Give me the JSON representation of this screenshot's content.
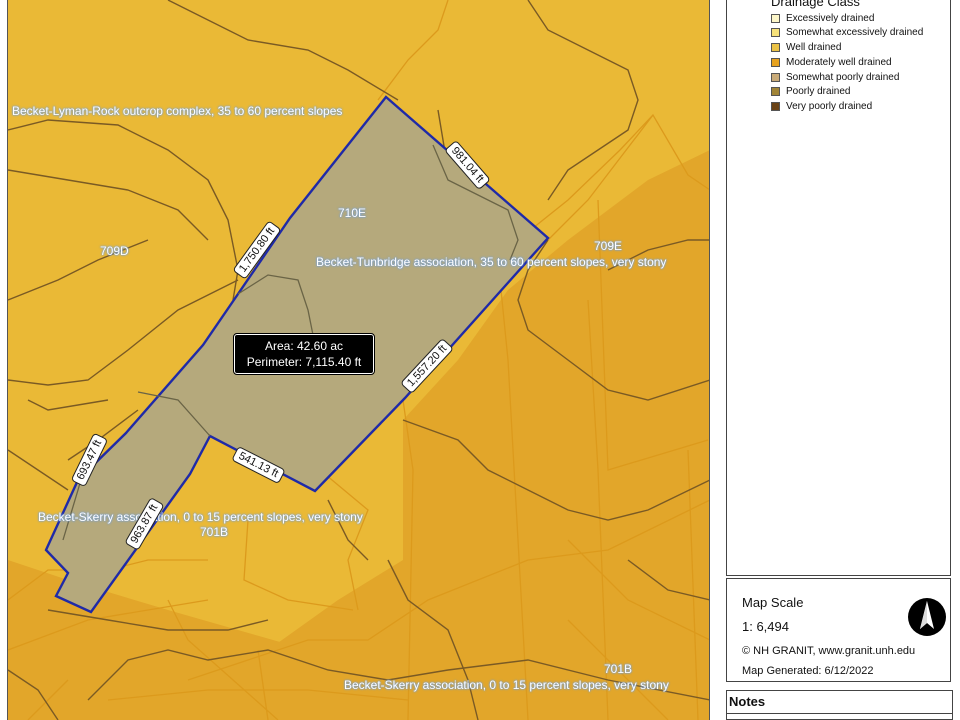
{
  "map": {
    "soil_units": [
      {
        "name": "Becket-Lyman-Rock outcrop complex, 35 to 60 percent slopes"
      },
      {
        "name": "Becket-Tunbridge association, 35 to 60 percent slopes, very stony"
      },
      {
        "name": "Becket-Skerry association, 0 to 15 percent slopes, very stony"
      },
      {
        "name": "Becket-Skerry association, 0 to 15 percent slopes, very stony"
      }
    ],
    "map_units": [
      "709D",
      "710E",
      "709E",
      "701B",
      "701B"
    ],
    "dimensions": [
      "981.04 ft",
      "1,750.80 ft",
      "1,557.20 ft",
      "693.47 ft",
      "541.13 ft",
      "963.87 ft"
    ],
    "area_text": "Area: 42.60 ac",
    "perimeter_text": "Perimeter: 7,115.40 ft",
    "parcel_outline_color": "#1f2aa8",
    "parcel_fill_color": "#b5a97c",
    "background_color": "#eab936"
  },
  "legend": {
    "title": "Drainage Class",
    "items": [
      {
        "label": "Excessively drained",
        "color": "#fdf7c9"
      },
      {
        "label": "Somewhat excessively drained",
        "color": "#f7e27a"
      },
      {
        "label": "Well drained",
        "color": "#eac246"
      },
      {
        "label": "Moderately well drained",
        "color": "#e6a21f"
      },
      {
        "label": "Somewhat poorly drained",
        "color": "#c9ab79"
      },
      {
        "label": "Poorly drained",
        "color": "#a18436"
      },
      {
        "label": "Very poorly drained",
        "color": "#6b4317"
      }
    ]
  },
  "scale": {
    "title": "Map Scale",
    "value": "1: 6,494",
    "credit": "© NH GRANIT, www.granit.unh.edu",
    "generated": "Map Generated:  6/12/2022"
  },
  "notes": {
    "title": "Notes"
  }
}
